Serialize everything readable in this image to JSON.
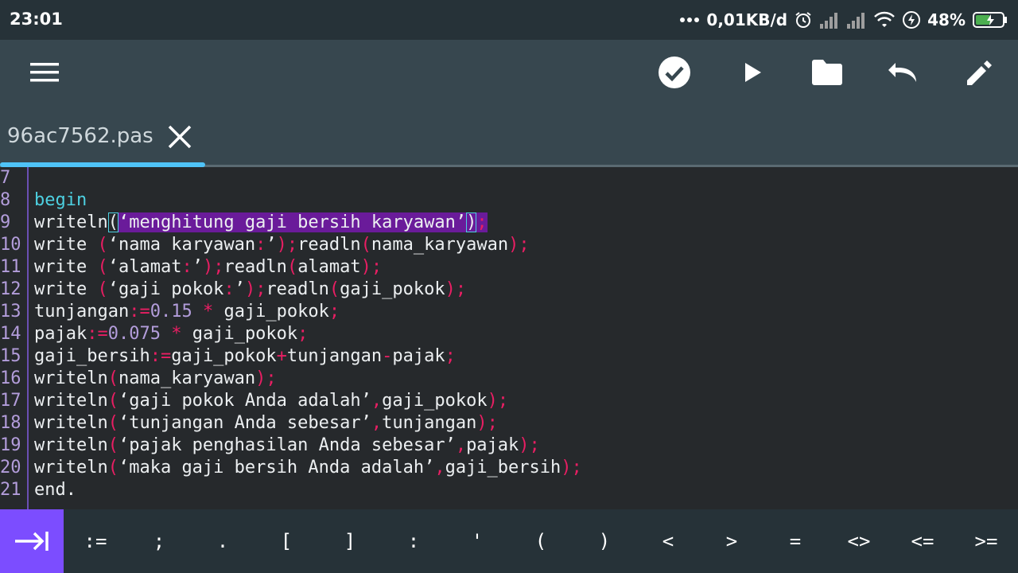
{
  "status": {
    "time": "23:01",
    "net_speed": "0,01KB/d",
    "battery": "48%"
  },
  "toolbar": {
    "menu_icon": "menu-icon",
    "compile_icon": "check-circle-icon",
    "run_icon": "play-icon",
    "open_icon": "folder-icon",
    "undo_icon": "undo-icon",
    "edit_icon": "pencil-icon"
  },
  "tab": {
    "filename": "96ac7562.pas"
  },
  "editor": {
    "lines": [
      {
        "num": "7",
        "tokens": []
      },
      {
        "num": "8",
        "tokens": [
          {
            "t": "begin",
            "c": "kw"
          }
        ]
      },
      {
        "num": "9",
        "tokens": [
          {
            "t": "writeln"
          },
          {
            "t": "(",
            "c": "box"
          },
          {
            "t": "‘menghitung gaji bersih karyawan’",
            "c": "hl"
          },
          {
            "t": ")",
            "c": "box hl"
          },
          {
            "t": ";",
            "c": "op hl"
          }
        ]
      },
      {
        "num": "10",
        "tokens": [
          {
            "t": "write "
          },
          {
            "t": "(",
            "c": "op"
          },
          {
            "t": "‘nama karyawan"
          },
          {
            "t": ":",
            "c": "op"
          },
          {
            "t": "’"
          },
          {
            "t": ")",
            "c": "op"
          },
          {
            "t": ";",
            "c": "op"
          },
          {
            "t": "readln"
          },
          {
            "t": "(",
            "c": "op"
          },
          {
            "t": "nama_karyawan"
          },
          {
            "t": ")",
            "c": "op"
          },
          {
            "t": ";",
            "c": "op"
          }
        ]
      },
      {
        "num": "11",
        "tokens": [
          {
            "t": "write "
          },
          {
            "t": "(",
            "c": "op"
          },
          {
            "t": "‘alamat"
          },
          {
            "t": ":",
            "c": "op"
          },
          {
            "t": "’"
          },
          {
            "t": ")",
            "c": "op"
          },
          {
            "t": ";",
            "c": "op"
          },
          {
            "t": "readln"
          },
          {
            "t": "(",
            "c": "op"
          },
          {
            "t": "alamat"
          },
          {
            "t": ")",
            "c": "op"
          },
          {
            "t": ";",
            "c": "op"
          }
        ]
      },
      {
        "num": "12",
        "tokens": [
          {
            "t": "write "
          },
          {
            "t": "(",
            "c": "op"
          },
          {
            "t": "‘gaji pokok"
          },
          {
            "t": ":",
            "c": "op"
          },
          {
            "t": "’"
          },
          {
            "t": ")",
            "c": "op"
          },
          {
            "t": ";",
            "c": "op"
          },
          {
            "t": "readln"
          },
          {
            "t": "(",
            "c": "op"
          },
          {
            "t": "gaji_pokok"
          },
          {
            "t": ")",
            "c": "op"
          },
          {
            "t": ";",
            "c": "op"
          }
        ]
      },
      {
        "num": "13",
        "tokens": [
          {
            "t": "tunjangan"
          },
          {
            "t": ":=",
            "c": "op"
          },
          {
            "t": "0.15",
            "c": "num"
          },
          {
            "t": " "
          },
          {
            "t": "*",
            "c": "op"
          },
          {
            "t": " gaji_pokok"
          },
          {
            "t": ";",
            "c": "op"
          }
        ]
      },
      {
        "num": "14",
        "tokens": [
          {
            "t": "pajak"
          },
          {
            "t": ":=",
            "c": "op"
          },
          {
            "t": "0.075",
            "c": "num"
          },
          {
            "t": " "
          },
          {
            "t": "*",
            "c": "op"
          },
          {
            "t": " gaji_pokok"
          },
          {
            "t": ";",
            "c": "op"
          }
        ]
      },
      {
        "num": "15",
        "tokens": [
          {
            "t": "gaji_bersih"
          },
          {
            "t": ":=",
            "c": "op"
          },
          {
            "t": "gaji_pokok"
          },
          {
            "t": "+",
            "c": "op"
          },
          {
            "t": "tunjangan"
          },
          {
            "t": "-",
            "c": "op"
          },
          {
            "t": "pajak"
          },
          {
            "t": ";",
            "c": "op"
          }
        ]
      },
      {
        "num": "16",
        "tokens": [
          {
            "t": "writeln"
          },
          {
            "t": "(",
            "c": "op"
          },
          {
            "t": "nama_karyawan"
          },
          {
            "t": ")",
            "c": "op"
          },
          {
            "t": ";",
            "c": "op"
          }
        ]
      },
      {
        "num": "17",
        "tokens": [
          {
            "t": "writeln"
          },
          {
            "t": "(",
            "c": "op"
          },
          {
            "t": "‘gaji pokok Anda adalah’"
          },
          {
            "t": ",",
            "c": "op"
          },
          {
            "t": "gaji_pokok"
          },
          {
            "t": ")",
            "c": "op"
          },
          {
            "t": ";",
            "c": "op"
          }
        ]
      },
      {
        "num": "18",
        "tokens": [
          {
            "t": "writeln"
          },
          {
            "t": "(",
            "c": "op"
          },
          {
            "t": "‘tunjangan Anda sebesar’"
          },
          {
            "t": ",",
            "c": "op"
          },
          {
            "t": "tunjangan"
          },
          {
            "t": ")",
            "c": "op"
          },
          {
            "t": ";",
            "c": "op"
          }
        ]
      },
      {
        "num": "19",
        "tokens": [
          {
            "t": "writeln"
          },
          {
            "t": "(",
            "c": "op"
          },
          {
            "t": "‘pajak penghasilan Anda sebesar’"
          },
          {
            "t": ",",
            "c": "op"
          },
          {
            "t": "pajak"
          },
          {
            "t": ")",
            "c": "op"
          },
          {
            "t": ";",
            "c": "op"
          }
        ]
      },
      {
        "num": "20",
        "tokens": [
          {
            "t": "writeln"
          },
          {
            "t": "(",
            "c": "op"
          },
          {
            "t": "‘maka gaji bersih Anda adalah’"
          },
          {
            "t": ",",
            "c": "op"
          },
          {
            "t": "gaji_bersih"
          },
          {
            "t": ")",
            "c": "op"
          },
          {
            "t": ";",
            "c": "op"
          }
        ]
      },
      {
        "num": "21",
        "tokens": [
          {
            "t": "end."
          }
        ]
      }
    ]
  },
  "keys": {
    "tab_icon": "tab-arrow-icon",
    "symbols": [
      ":=",
      ";",
      ".",
      "[",
      "]",
      ":",
      "'",
      "(",
      ")",
      "<",
      ">",
      "=",
      "<>",
      "<=",
      ">="
    ]
  },
  "colors": {
    "accent": "#7c4dff",
    "tab_indicator": "#4fc3f7",
    "toolbar": "#37474f",
    "editor_bg": "#26292c"
  }
}
